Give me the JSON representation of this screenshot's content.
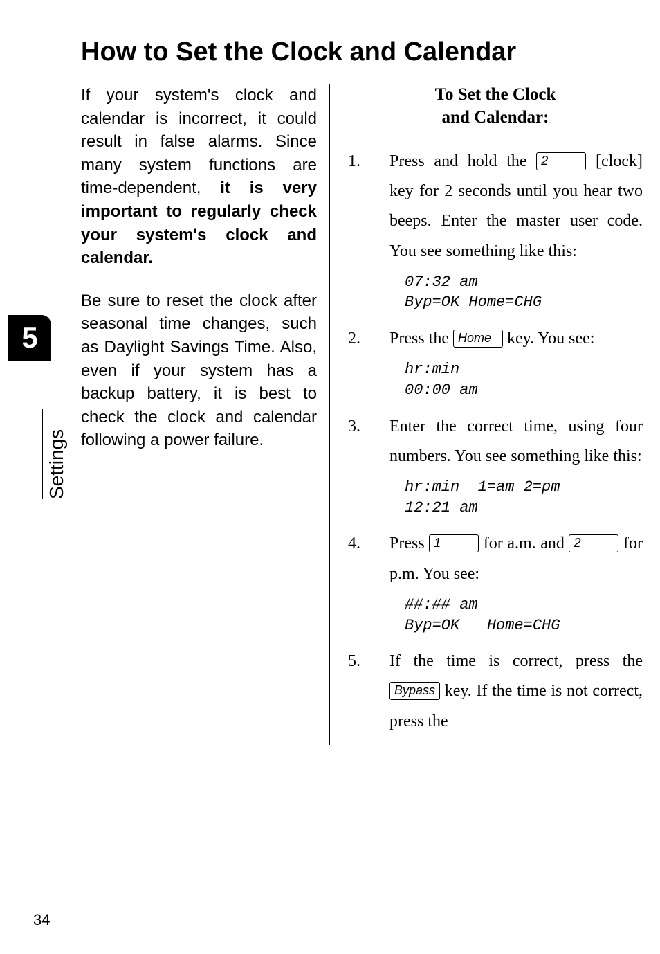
{
  "side": {
    "chapter_number": "5",
    "section_label": "Settings"
  },
  "header": {
    "title": "How to Set the Clock and Calendar"
  },
  "left": {
    "para1_a": "If your system's clock and calendar is incorrect, it could result in false alarms.  Since many system functions are time-dependent, ",
    "para1_b": "it is very important to regularly check your system's clock and calendar.",
    "para2": "Be sure to reset the clock after seasonal time changes, such as Daylight Savings Time.  Also, even if your system has a backup battery, it is best to check the clock and calendar following a power failure."
  },
  "right": {
    "subhead_l1": "To Set the Clock",
    "subhead_l2": "and Calendar:",
    "steps": [
      {
        "pre": "Press and hold the ",
        "key1": "2",
        "post": " [clock] key for 2 seconds until you hear two beeps. Enter the master user code.  You see something like this:",
        "display": "07:32 am\nByp=OK Home=CHG"
      },
      {
        "pre": "Press the ",
        "key1": "Home",
        "mid": " key.  You see:",
        "display": "hr:min\n00:00 am"
      },
      {
        "text": "Enter the correct time, using four numbers.  You see something like this:",
        "display": "hr:min  1=am 2=pm\n12:21 am"
      },
      {
        "pre": "Press ",
        "key1": "1",
        "mid": " for a.m. and ",
        "key2": "2",
        "post": " for p.m.  You see:",
        "display": "##:## am\nByp=OK   Home=CHG"
      },
      {
        "pre": "If the time is correct, press the ",
        "key1": "Bypass",
        "post": " key.  If the time is not correct, press the"
      }
    ]
  },
  "page_number": "34"
}
